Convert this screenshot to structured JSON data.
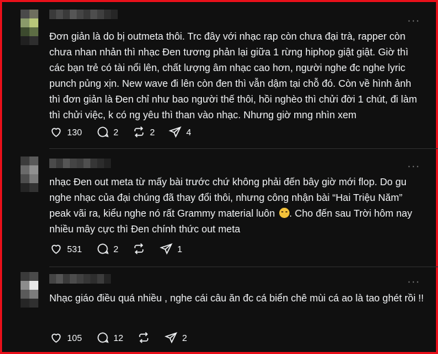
{
  "colors": {
    "background": "#101010",
    "text": "#f3f5f7",
    "muted": "#8a8a8a",
    "border": "#e8101a",
    "divider": "#2d2d2d",
    "emoji": "#f3c23a"
  },
  "more_label": "···",
  "posts": [
    {
      "text": "Đơn giản là do bị outmeta thôi. Trc đây với nhạc rap còn chưa đại trà, rapper còn chưa nhan nhản thì nhạc Đen tương phản lại giữa 1 rừng hiphop giật giật. Giờ thì các bạn trẻ có tài nổi lên, chất lượng âm nhạc cao hơn, người nghe đc nghe lyric punch pủng xịn. New wave đi lên còn đen thì vẫn dậm tại chỗ đó. Còn về hình ảnh thì đơn giản là Đen chỉ như bao người thế thôi, hồi nghèo thì chửi đời 1 chút, đi làm thì chửi việc, k có ng yêu thì than vào nhạc. Nhưng giờ mng nhìn xem",
      "likes": "130",
      "replies": "2",
      "reposts": "2",
      "shares": "4"
    },
    {
      "text": "nhạc Đen out meta từ mấy bài trước chứ không phải đến bây giờ mới flop. Do gu nghe nhạc của đại chúng đã thay đổi thôi, nhưng công nhận bài “Hai Triệu Năm” peak vãi ra, kiểu nghe nó rất Grammy material luôn",
      "text_after_emoji": ". Cho đến sau Trời hôm nay nhiều mây cực thì Đen chính thức out meta",
      "emoji_icon": "sweat-smile-emoji",
      "likes": "531",
      "replies": "2",
      "reposts": "",
      "shares": "1"
    },
    {
      "text": "Nhạc giáo điều quá nhiều , nghe cái câu ăn đc cá biển chê mùi cá ao là tao ghét rồi !!",
      "likes": "105",
      "replies": "12",
      "reposts": "",
      "shares": "2"
    }
  ],
  "icons": {
    "like": "heart-icon",
    "reply": "comment-icon",
    "repost": "repost-icon",
    "share": "share-icon",
    "more": "more-icon"
  }
}
